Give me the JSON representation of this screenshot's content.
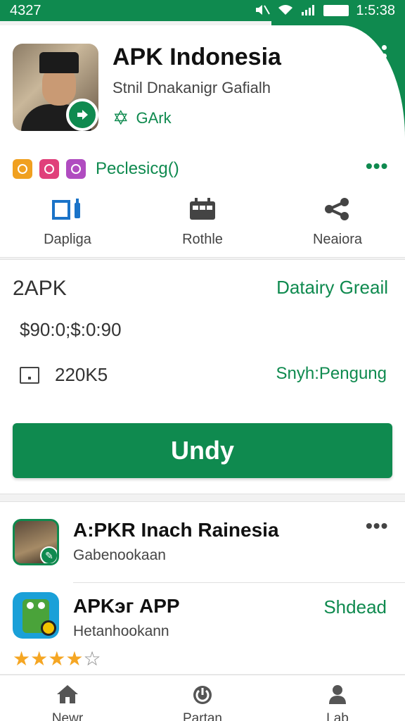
{
  "status_bar": {
    "left_text": "4327",
    "time": "1:5:38"
  },
  "app": {
    "title": "APK Indonesia",
    "subtitle": "Stnil Dnakanigr Gafialh",
    "badge_label": "GArk"
  },
  "social": {
    "label": "Peclesicg()"
  },
  "actions": [
    {
      "label": "Dapliga",
      "icon": "device-icon"
    },
    {
      "label": "Rothle",
      "icon": "calendar-icon"
    },
    {
      "label": "Neaiora",
      "icon": "share-icon"
    }
  ],
  "details": {
    "name": "2APK",
    "link": "Datairy Greail",
    "price": "$90:0;$:0:90",
    "size": "220K5",
    "status": "Snyh:Pengung",
    "install_label": "Undy"
  },
  "list": [
    {
      "title": "A:PKR Inach Rainesia",
      "subtitle": "Gabenookaan"
    },
    {
      "title": "APKэг APP",
      "subtitle": "Hetanhookann",
      "action": "Shdead",
      "rating": 4
    }
  ],
  "bottom_nav": [
    {
      "label": "Newr",
      "icon": "home-icon"
    },
    {
      "label": "Partan",
      "icon": "power-icon"
    },
    {
      "label": "Lab",
      "icon": "person-icon"
    }
  ],
  "colors": {
    "accent": "#0f8a4f",
    "star": "#f5a623"
  }
}
